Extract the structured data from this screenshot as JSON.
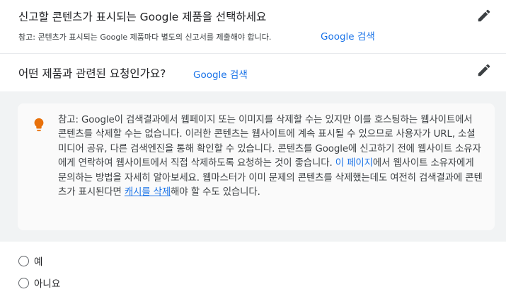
{
  "section1": {
    "title": "신고할 콘텐츠가 표시되는 Google 제품을 선택하세요",
    "note": "참고: 콘텐츠가 표시되는 Google 제품마다 별도의 신고서를 제출해야 합니다.",
    "value": "Google 검색",
    "edit_icon": "pencil-icon"
  },
  "section2": {
    "title": "어떤 제품과 관련된 요청인가요?",
    "value": "Google 검색",
    "edit_icon": "pencil-icon"
  },
  "info": {
    "icon": "lightbulb-icon",
    "text_1": "참고: Google이 검색결과에서 웹페이지 또는 이미지를 삭제할 수는 있지만 이를 호스팅하는 웹사이트에서 콘텐츠를 삭제할 수는 없습니다. 이러한 콘텐츠는 웹사이트에 계속 표시될 수 있으므로 사용자가 URL, 소셜 미디어 공유, 다른 검색엔진을 통해 확인할 수 있습니다. 콘텐츠를 Google에 신고하기 전에 웹사이트 소유자에게 연락하여 웹사이트에서 직접 삭제하도록 요청하는 것이 좋습니다. ",
    "link_1": "이 페이지",
    "text_2": "에서 웹사이트 소유자에게 문의하는 방법을 자세히 알아보세요. 웹마스터가 이미 문제의 콘텐츠를 삭제했는데도 여전히 검색결과에 콘텐츠가 표시된다면 ",
    "link_2": "캐시를 삭제",
    "text_3": "해야 할 수도 있습니다."
  },
  "options": [
    {
      "label": "예",
      "selected": false
    },
    {
      "label": "아니요",
      "selected": false
    }
  ],
  "colors": {
    "link": "#1a73e8",
    "icon": "#5f6368",
    "bulb": "#e8710a",
    "panel": "#f1f3f4"
  }
}
